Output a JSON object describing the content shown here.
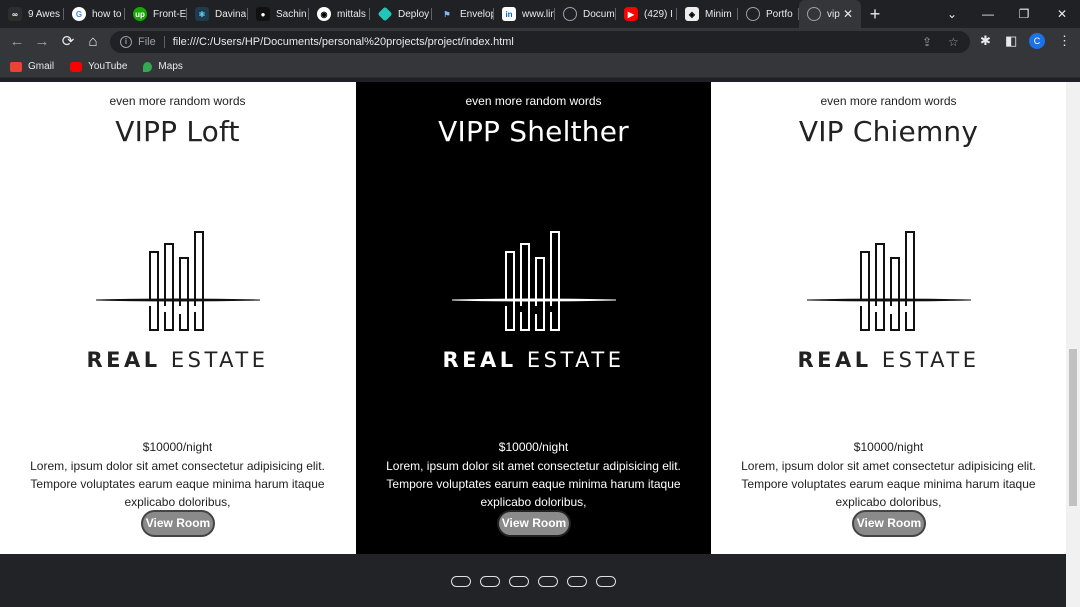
{
  "browser": {
    "tabs": [
      {
        "label": "9 Awes",
        "icon": "codepen-icon",
        "color": "#2d2d2d"
      },
      {
        "label": "how to",
        "icon": "google-icon",
        "color": "#ffffff"
      },
      {
        "label": "Front-E",
        "icon": "upwork-icon",
        "color": "#14a800"
      },
      {
        "label": "Davina",
        "icon": "react-icon",
        "color": "#61dafb"
      },
      {
        "label": "Sachin",
        "icon": "app-icon",
        "color": "#111111"
      },
      {
        "label": "mittals",
        "icon": "github-icon",
        "color": "#ffffff"
      },
      {
        "label": "Deploy",
        "icon": "netlify-icon",
        "color": "#20c6b7"
      },
      {
        "label": "Envelop",
        "icon": "flag-icon",
        "color": "#8ab4f8"
      },
      {
        "label": "www.lin",
        "icon": "linkedin-icon",
        "color": "#ffffff"
      },
      {
        "label": "Docum",
        "icon": "globe-icon",
        "color": "#9aa0a6"
      },
      {
        "label": "(429) I",
        "icon": "youtube-icon",
        "color": "#ff0000"
      },
      {
        "label": "Minim",
        "icon": "app-icon",
        "color": "#eeeeee"
      },
      {
        "label": "Portfo",
        "icon": "globe-icon",
        "color": "#9aa0a6"
      },
      {
        "label": "vip",
        "icon": "globe-icon",
        "color": "#9aa0a6",
        "active": true
      }
    ],
    "new_tab": "+",
    "window_controls": {
      "menu": "⌄",
      "minimize": "—",
      "restore": "❐",
      "close": "✕"
    },
    "toolbar": {
      "back": "←",
      "forward": "→",
      "reload": "⟳",
      "home": "⌂",
      "scheme": "File",
      "url": "file:///C:/Users/HP/Documents/personal%20projects/project/index.html",
      "profile_initial": "C"
    },
    "bookmarks": [
      {
        "label": "Gmail",
        "color": "#ea4335"
      },
      {
        "label": "YouTube",
        "color": "#ff0000"
      },
      {
        "label": "Maps",
        "color": "#34a853"
      }
    ]
  },
  "cards": [
    {
      "theme": "light",
      "eyebrow": "even more random words",
      "title": "VIPP Loft",
      "logo_bold": "REAL",
      "logo_rest": " ESTATE",
      "price": "$10000/night",
      "description": "Lorem, ipsum dolor sit amet consectetur adipisicing elit. Tempore voluptates earum eaque minima harum itaque explicabo doloribus,",
      "button": "View Room"
    },
    {
      "theme": "dark",
      "eyebrow": "even more random words",
      "title": "VIPP Shelther",
      "logo_bold": "REAL",
      "logo_rest": " ESTATE",
      "price": "$10000/night",
      "description": "Lorem, ipsum dolor sit amet consectetur adipisicing elit. Tempore voluptates earum eaque minima harum itaque explicabo doloribus,",
      "button": "View Room"
    },
    {
      "theme": "light",
      "eyebrow": "even more random words",
      "title": "VIP Chiemny",
      "logo_bold": "REAL",
      "logo_rest": " ESTATE",
      "price": "$10000/night",
      "description": "Lorem, ipsum dolor sit amet consectetur adipisicing elit. Tempore voluptates earum eaque minima harum itaque explicabo doloribus,",
      "button": "View Room"
    }
  ],
  "carousel": {
    "dot_count": 6
  }
}
